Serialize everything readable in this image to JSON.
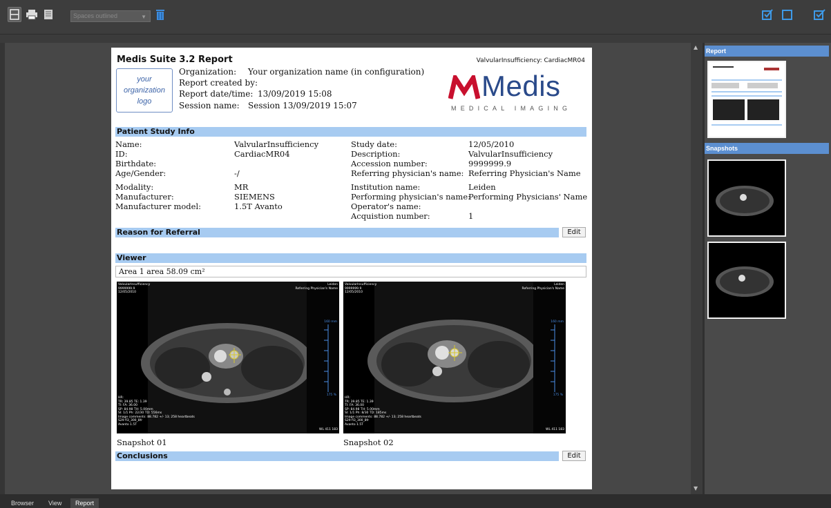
{
  "toolbar": {
    "select_value": "Spaces outlined",
    "icons": [
      "single-page-icon",
      "print-icon",
      "document-icon",
      "trash-icon",
      "check-box-icon",
      "square-icon",
      "edit-check-icon"
    ]
  },
  "report": {
    "title": "Medis Suite 3.2 Report",
    "study_id": "ValvularInsufficiency: CardiacMR04",
    "logo_placeholder": [
      "your",
      "organization",
      "logo"
    ],
    "meta": {
      "organization_label": "Organization:",
      "organization_value": "Your organization name (in configuration)",
      "created_label": "Report created by:",
      "date_label": "Report date/time:",
      "date_value": "13/09/2019 15:08",
      "session_label": "Session name:",
      "session_value": "Session 13/09/2019 15:07"
    },
    "brand": {
      "name": "Medis",
      "tagline": "MEDICAL IMAGING",
      "color": "#c8102e"
    },
    "sections": {
      "patient": "Patient Study Info",
      "referral": "Reason for Referral",
      "viewer": "Viewer",
      "conclusions": "Conclusions"
    },
    "patient_left": [
      {
        "label": "Name:",
        "value": "ValvularInsufficiency"
      },
      {
        "label": "ID:",
        "value": "CardiacMR04"
      },
      {
        "label": "Birthdate:",
        "value": ""
      },
      {
        "label": "Age/Gender:",
        "value": "-/"
      },
      {
        "label": "Modality:",
        "value": "MR"
      },
      {
        "label": "Manufacturer:",
        "value": "SIEMENS"
      },
      {
        "label": "Manufacturer model:",
        "value": "1.5T Avanto"
      }
    ],
    "patient_right": [
      {
        "label": "Study date:",
        "value": "12/05/2010"
      },
      {
        "label": "Description:",
        "value": "ValvularInsufficiency"
      },
      {
        "label": "Accession number:",
        "value": "9999999.9"
      },
      {
        "label": "Referring physician's name:",
        "value": "Referring Physician's Name"
      },
      {
        "label": "Institution name:",
        "value": "Leiden"
      },
      {
        "label": "Performing physician's name:",
        "value": "Performing Physicians' Name"
      },
      {
        "label": "Operator's name:",
        "value": ""
      },
      {
        "label": "Acquistion number:",
        "value": "1"
      }
    ],
    "edit_label": "Edit",
    "area_text": "Area 1 area 58.09 cm²",
    "snapshots": [
      {
        "label": "Snapshot 01",
        "overlay_tl": "ValvularInsufficiency\n9999999.9\n12/05/2010",
        "overlay_tr": "Leiden\nReferring Physician's Name",
        "scale_top": "160 mm",
        "scale_pct": "175 %",
        "overlay_bl": "HR:\nTR: 39.85 TE: 1.39\nTI: FA: 36.00\nSP: 84.98 TH: 5.00mm\nSI: 1/1 Ph: 22/30 TD: 556ms\nImage comments: 88.782 +/- 13; 258 heartbeats\nS29 fl3_300_8fr\nAvanto 1.5T",
        "overlay_br": "WL 411 183"
      },
      {
        "label": "Snapshot 02",
        "overlay_tl": "ValvularInsufficiency\n9999999.9\n12/05/2010",
        "overlay_tr": "Leiden\nReferring Physician's Name",
        "scale_top": "160 mm",
        "scale_pct": "175 %",
        "overlay_bl": "HR:\nTR: 39.85 TE: 1.39\nTI: FA: 36.00\nSP: 84.98 TH: 5.00mm\nSI: 1/1 Ph: 8/30 TD: 185ms\nImage comments: 88.782 +/- 13; 258 heartbeats\nS29 fl3_300_8fr\nAvanto 1.5T",
        "overlay_br": "WL 411 183"
      }
    ]
  },
  "right_panel": {
    "report_header": "Report",
    "snapshots_header": "Snapshots"
  },
  "tabs": [
    "Browser",
    "View",
    "Report"
  ]
}
